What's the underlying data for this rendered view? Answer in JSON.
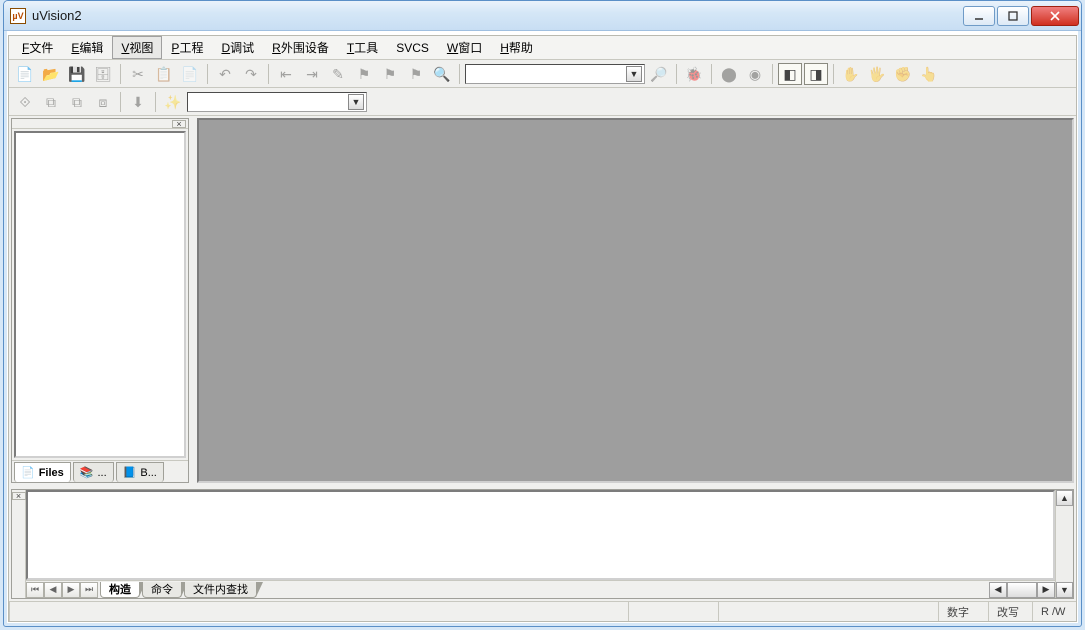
{
  "window": {
    "title": "uVision2",
    "icon_glyph": "µV"
  },
  "menu": [
    {
      "u": "F",
      "rest": "文件"
    },
    {
      "u": "E",
      "rest": "编辑"
    },
    {
      "u": "V",
      "rest": "视图",
      "active": true
    },
    {
      "u": "P",
      "rest": "工程"
    },
    {
      "u": "D",
      "rest": "调试"
    },
    {
      "u": "R",
      "rest": "外围设备"
    },
    {
      "u": "T",
      "rest": "工具"
    },
    {
      "u": "",
      "rest": "SVCS",
      "plain": true
    },
    {
      "u": "W",
      "rest": "窗口"
    },
    {
      "u": "H",
      "rest": "帮助"
    }
  ],
  "toolbar1": {
    "search_value": ""
  },
  "toolbar2": {
    "target_value": ""
  },
  "project_tabs": [
    {
      "label": "Files",
      "icon": "📄",
      "active": true
    },
    {
      "label": "...",
      "icon": "📚",
      "active": false
    },
    {
      "label": "B...",
      "icon": "📘",
      "active": false
    }
  ],
  "output_tabs": [
    {
      "label": "构造",
      "active": true
    },
    {
      "label": "命令",
      "active": false
    },
    {
      "label": "文件内查找",
      "active": false
    }
  ],
  "status": {
    "cell1": "",
    "cell2": "",
    "cell3": "",
    "num": "数字",
    "ovr": "改写",
    "rw": "R /W"
  }
}
